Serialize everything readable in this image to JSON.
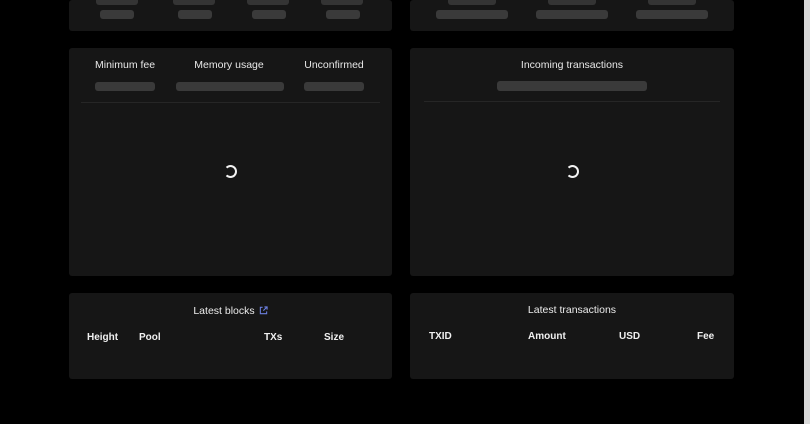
{
  "mempool": {
    "labels": {
      "minimum_fee": "Minimum fee",
      "memory_usage": "Memory usage",
      "unconfirmed": "Unconfirmed"
    }
  },
  "incoming": {
    "label": "Incoming transactions"
  },
  "latest_blocks": {
    "title": "Latest blocks",
    "link_icon": "external-link-icon",
    "columns": [
      "Height",
      "Pool",
      "TXs",
      "Size"
    ]
  },
  "latest_transactions": {
    "title": "Latest transactions",
    "columns": [
      "TXID",
      "Amount",
      "USD",
      "Fee"
    ]
  },
  "colors": {
    "background": "#000000",
    "panel": "#161616",
    "skeleton": "#3a3a3a",
    "link_icon": "#6b7fe0"
  }
}
